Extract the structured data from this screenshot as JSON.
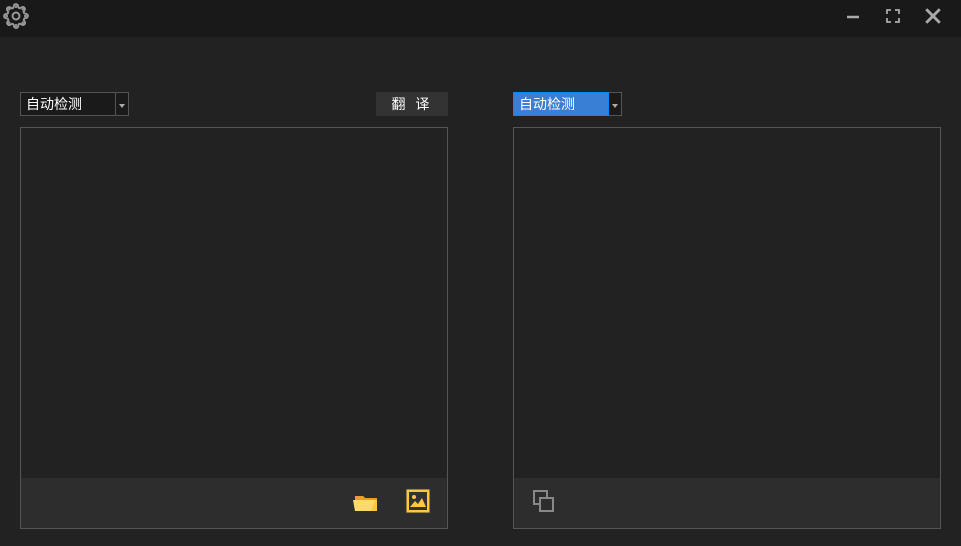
{
  "window": {
    "settings_icon": "settings",
    "minimize_icon": "minimize",
    "maximize_icon": "maximize",
    "close_icon": "close"
  },
  "source": {
    "language_select": "自动检测",
    "translate_button": "翻 译",
    "text": ""
  },
  "target": {
    "language_select": "自动检测",
    "text": ""
  },
  "icons": {
    "folder": "folder-icon",
    "screenshot": "screenshot-icon",
    "copy": "copy-icon"
  }
}
